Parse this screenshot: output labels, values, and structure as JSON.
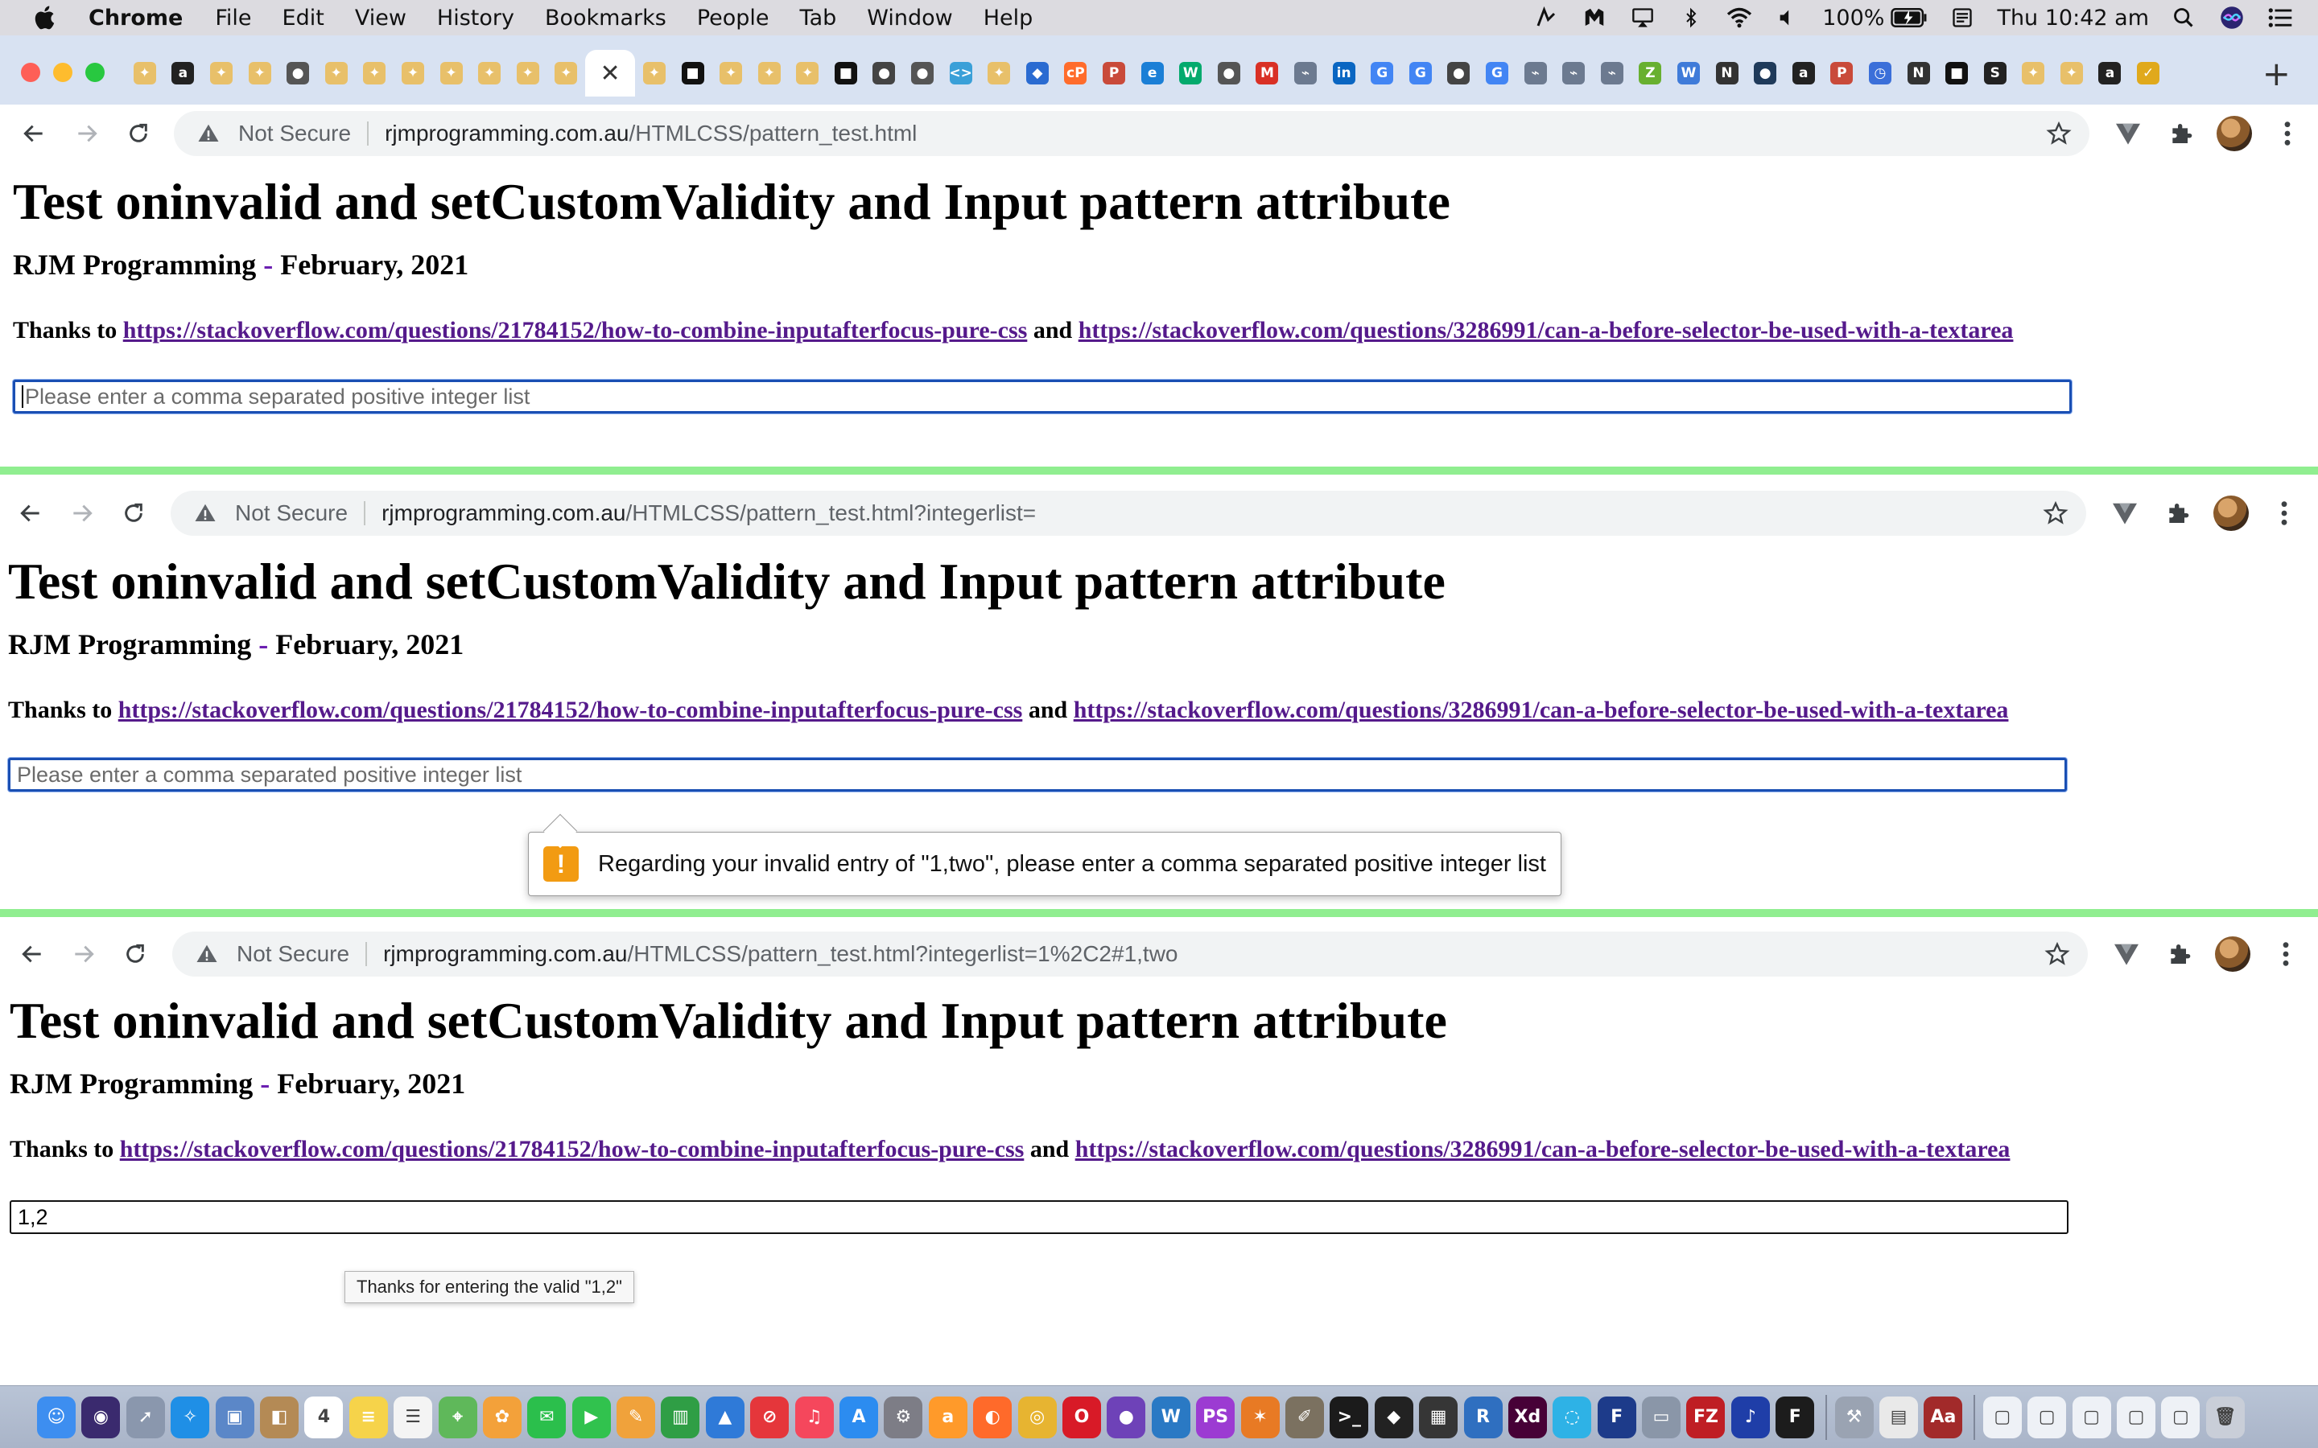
{
  "menubar": {
    "app": "Chrome",
    "items": [
      "File",
      "Edit",
      "View",
      "History",
      "Bookmarks",
      "People",
      "Tab",
      "Window",
      "Help"
    ],
    "battery": "100%",
    "clock": "Thu 10:42 am"
  },
  "tabstrip": {
    "favicons": [
      {
        "icon": "compass-favicon",
        "color": "#e8c06a",
        "glyph": "✦"
      },
      {
        "icon": "a-favicon",
        "color": "#222222",
        "glyph": "a"
      },
      {
        "icon": "compass-favicon",
        "color": "#e8c06a",
        "glyph": "✦"
      },
      {
        "icon": "compass-favicon",
        "color": "#e8c06a",
        "glyph": "✦"
      },
      {
        "icon": "octocat-favicon",
        "color": "#555555",
        "glyph": "●"
      },
      {
        "icon": "compass-favicon",
        "color": "#e8c06a",
        "glyph": "✦"
      },
      {
        "icon": "compass-favicon",
        "color": "#e8c06a",
        "glyph": "✦"
      },
      {
        "icon": "compass-favicon",
        "color": "#e8c06a",
        "glyph": "✦"
      },
      {
        "icon": "compass-favicon",
        "color": "#e8c06a",
        "glyph": "✦"
      },
      {
        "icon": "compass-favicon",
        "color": "#e8c06a",
        "glyph": "✦"
      },
      {
        "icon": "compass-favicon",
        "color": "#e8c06a",
        "glyph": "✦"
      },
      {
        "icon": "compass-favicon",
        "color": "#e8c06a",
        "glyph": "✦"
      }
    ],
    "favicons_after": [
      {
        "icon": "compass-favicon",
        "color": "#e8c06a",
        "glyph": "✦"
      },
      {
        "icon": "dark-square-favicon",
        "color": "#111111",
        "glyph": "■"
      },
      {
        "icon": "compass-favicon",
        "color": "#e8c06a",
        "glyph": "✦"
      },
      {
        "icon": "compass-favicon",
        "color": "#e8c06a",
        "glyph": "✦"
      },
      {
        "icon": "compass-favicon",
        "color": "#e8c06a",
        "glyph": "✦"
      },
      {
        "icon": "dark-square-favicon",
        "color": "#111111",
        "glyph": "■"
      },
      {
        "icon": "globe-favicon",
        "color": "#444444",
        "glyph": "●"
      },
      {
        "icon": "octocat-favicon",
        "color": "#555555",
        "glyph": "●"
      },
      {
        "icon": "code-favicon",
        "color": "#3aa0d8",
        "glyph": "<>"
      },
      {
        "icon": "compass-favicon",
        "color": "#e8c06a",
        "glyph": "✦"
      },
      {
        "icon": "blue-app-favicon",
        "color": "#2a6bd1",
        "glyph": "◆"
      },
      {
        "icon": "cpanel-favicon",
        "color": "#ff6c2c",
        "glyph": "cP"
      },
      {
        "icon": "psea-favicon",
        "color": "#c94a3a",
        "glyph": "P"
      },
      {
        "icon": "edge-favicon",
        "color": "#1b7fd6",
        "glyph": "e"
      },
      {
        "icon": "w3schools-favicon",
        "color": "#04aa6d",
        "glyph": "W"
      },
      {
        "icon": "octocat-favicon",
        "color": "#555555",
        "glyph": "●"
      },
      {
        "icon": "gmail-favicon",
        "color": "#d93025",
        "glyph": "M"
      },
      {
        "icon": "antenna-favicon",
        "color": "#6c7a90",
        "glyph": "⌁"
      },
      {
        "icon": "linkedin-favicon",
        "color": "#0a66c2",
        "glyph": "in"
      },
      {
        "icon": "google-favicon",
        "color": "#4285f4",
        "glyph": "G"
      },
      {
        "icon": "google-favicon",
        "color": "#4285f4",
        "glyph": "G"
      },
      {
        "icon": "globe-favicon",
        "color": "#444444",
        "glyph": "●"
      },
      {
        "icon": "google-favicon",
        "color": "#4285f4",
        "glyph": "G"
      },
      {
        "icon": "antenna-favicon",
        "color": "#6c7a90",
        "glyph": "⌁"
      },
      {
        "icon": "antenna-favicon",
        "color": "#6c7a90",
        "glyph": "⌁"
      },
      {
        "icon": "antenna-favicon",
        "color": "#6c7a90",
        "glyph": "⌁"
      },
      {
        "icon": "zend-favicon",
        "color": "#68b030",
        "glyph": "Z"
      },
      {
        "icon": "wordpress-favicon",
        "color": "#3f7bd9",
        "glyph": "W"
      },
      {
        "icon": "n-favicon",
        "color": "#333333",
        "glyph": "N"
      },
      {
        "icon": "dark-circle-favicon",
        "color": "#1f3a5a",
        "glyph": "●"
      },
      {
        "icon": "a-favicon",
        "color": "#222222",
        "glyph": "a"
      },
      {
        "icon": "psea-favicon",
        "color": "#c94a3a",
        "glyph": "P"
      },
      {
        "icon": "history-favicon",
        "color": "#3b6fd9",
        "glyph": "◷"
      },
      {
        "icon": "n-favicon",
        "color": "#333333",
        "glyph": "N"
      },
      {
        "icon": "dark-square-favicon",
        "color": "#111111",
        "glyph": "■"
      },
      {
        "icon": "s-favicon",
        "color": "#222222",
        "glyph": "S"
      },
      {
        "icon": "compass-favicon",
        "color": "#e8c06a",
        "glyph": "✦"
      },
      {
        "icon": "compass-favicon",
        "color": "#e8c06a",
        "glyph": "✦"
      },
      {
        "icon": "a-favicon",
        "color": "#222222",
        "glyph": "a"
      },
      {
        "icon": "check-favicon",
        "color": "#e0a91c",
        "glyph": "✓"
      }
    ]
  },
  "panels": [
    {
      "url_host": "rjmprogramming.com.au",
      "url_path": "/HTMLCSS/pattern_test.html",
      "input_value": "",
      "input_placeholder": "Please enter a comma separated positive integer list"
    },
    {
      "url_host": "rjmprogramming.com.au",
      "url_path": "/HTMLCSS/pattern_test.html?integerlist=",
      "input_value": "",
      "input_placeholder": "Please enter a comma separated positive integer list",
      "bubble": "Regarding your invalid entry of \"1,two\", please enter a comma separated positive integer list"
    },
    {
      "url_host": "rjmprogramming.com.au",
      "url_path": "/HTMLCSS/pattern_test.html?integerlist=1%2C2#1,two",
      "input_value": "1,2",
      "input_placeholder": "",
      "tooltip": "Thanks for entering the valid \"1,2\""
    }
  ],
  "page": {
    "not_secure": "Not Secure",
    "title": "Test oninvalid and setCustomValidity and Input pattern attribute",
    "byline_author": "RJM Programming",
    "byline_dash": "-",
    "byline_date": "February, 2021",
    "thanks_prefix": "Thanks to",
    "link1": "https://stackoverflow.com/questions/21784152/how-to-combine-inputafterfocus-pure-css",
    "thanks_and": "and",
    "link2": "https://stackoverflow.com/questions/3286991/can-a-before-selector-be-used-with-a-textarea"
  },
  "colors": {
    "divider": "#90ee90",
    "link": "#551a8b",
    "focus": "#1a4fb3",
    "warning": "#f29b12"
  },
  "dock": {
    "apps": [
      {
        "icon": "finder-icon",
        "color": "#3d8ef0",
        "glyph": "☺"
      },
      {
        "icon": "siri-icon",
        "color": "#3a2a6e",
        "glyph": "◉"
      },
      {
        "icon": "launchpad-icon",
        "color": "#8a97ad",
        "glyph": "➚"
      },
      {
        "icon": "safari-icon",
        "color": "#1f8fe6",
        "glyph": "✧"
      },
      {
        "icon": "preview-icon",
        "color": "#5b87c8",
        "glyph": "▣"
      },
      {
        "icon": "contacts-icon",
        "color": "#b48a55",
        "glyph": "◧"
      },
      {
        "icon": "calendar-icon",
        "color": "#ffffff",
        "glyph": "4"
      },
      {
        "icon": "notes-icon",
        "color": "#f6d34a",
        "glyph": "≡"
      },
      {
        "icon": "reminders-icon",
        "color": "#f4f4f4",
        "glyph": "☰"
      },
      {
        "icon": "maps-icon",
        "color": "#5fb85a",
        "glyph": "⌖"
      },
      {
        "icon": "photos-icon",
        "color": "#f3a13a",
        "glyph": "✿"
      },
      {
        "icon": "messages-icon",
        "color": "#2bbf4c",
        "glyph": "✉"
      },
      {
        "icon": "facetime-icon",
        "color": "#31c24e",
        "glyph": "▶"
      },
      {
        "icon": "pages-icon",
        "color": "#f0a23b",
        "glyph": "✎"
      },
      {
        "icon": "numbers-icon",
        "color": "#2f9e45",
        "glyph": "▥"
      },
      {
        "icon": "keynote-icon",
        "color": "#2f7ad8",
        "glyph": "▲"
      },
      {
        "icon": "news-icon",
        "color": "#e5363b",
        "glyph": "⊘"
      },
      {
        "icon": "music-icon",
        "color": "#f5475c",
        "glyph": "♫"
      },
      {
        "icon": "app-store-icon",
        "color": "#2c8cf0",
        "glyph": "A"
      },
      {
        "icon": "system-preferences-icon",
        "color": "#7d7d86",
        "glyph": "⚙"
      },
      {
        "icon": "amazon-icon",
        "color": "#ff9a2a",
        "glyph": "a"
      },
      {
        "icon": "firefox-icon",
        "color": "#ff6a2a",
        "glyph": "◐"
      },
      {
        "icon": "chrome-icon",
        "color": "#e7b431",
        "glyph": "◎"
      },
      {
        "icon": "opera-icon",
        "color": "#d81a27",
        "glyph": "O"
      },
      {
        "icon": "github-desktop-icon",
        "color": "#6e42b8",
        "glyph": "●"
      },
      {
        "icon": "wireshark-icon",
        "color": "#2a79c4",
        "glyph": "W"
      },
      {
        "icon": "phpstorm-icon",
        "color": "#9c3bd2",
        "glyph": "PS"
      },
      {
        "icon": "blender-icon",
        "color": "#e87a24",
        "glyph": "✶"
      },
      {
        "icon": "gimp-icon",
        "color": "#7b7160",
        "glyph": "✐"
      },
      {
        "icon": "terminal-icon",
        "color": "#1b1b1b",
        "glyph": ">_"
      },
      {
        "icon": "inkscape-icon",
        "color": "#222222",
        "glyph": "◆"
      },
      {
        "icon": "activity-monitor-icon",
        "color": "#363636",
        "glyph": "▦"
      },
      {
        "icon": "r-icon",
        "color": "#2f6fc0",
        "glyph": "R"
      },
      {
        "icon": "adobe-xd-icon",
        "color": "#470137",
        "glyph": "Xd"
      },
      {
        "icon": "colorsync-icon",
        "color": "#2eb2e6",
        "glyph": "◌"
      },
      {
        "icon": "f-icon",
        "color": "#1d3b8a",
        "glyph": "F"
      },
      {
        "icon": "drive-icon",
        "color": "#8a96a8",
        "glyph": "▭"
      },
      {
        "icon": "filezilla-icon",
        "color": "#bf1e24",
        "glyph": "FZ"
      },
      {
        "icon": "audacity-icon",
        "color": "#1f3ea8",
        "glyph": "♪"
      },
      {
        "icon": "f-dark-icon",
        "color": "#1c1c1c",
        "glyph": "F"
      }
    ],
    "apps_after": [
      {
        "icon": "utility-icon",
        "color": "#9aa3b2",
        "glyph": "⚒"
      },
      {
        "icon": "document-icon",
        "color": "#e9e9e9",
        "glyph": "▤"
      },
      {
        "icon": "dictionary-icon",
        "color": "#a22a2a",
        "glyph": "Aa"
      }
    ],
    "stack": [
      {
        "icon": "doc-stack-icon",
        "color": "#eef1f6",
        "glyph": "▢"
      },
      {
        "icon": "doc-stack-icon",
        "color": "#eef1f6",
        "glyph": "▢"
      },
      {
        "icon": "doc-stack-icon",
        "color": "#eef1f6",
        "glyph": "▢"
      },
      {
        "icon": "doc-stack-icon",
        "color": "#eef1f6",
        "glyph": "▢"
      },
      {
        "icon": "doc-stack-icon",
        "color": "#eef1f6",
        "glyph": "▢"
      },
      {
        "icon": "trash-icon",
        "color": "#c9ced8",
        "glyph": "🗑"
      }
    ]
  }
}
